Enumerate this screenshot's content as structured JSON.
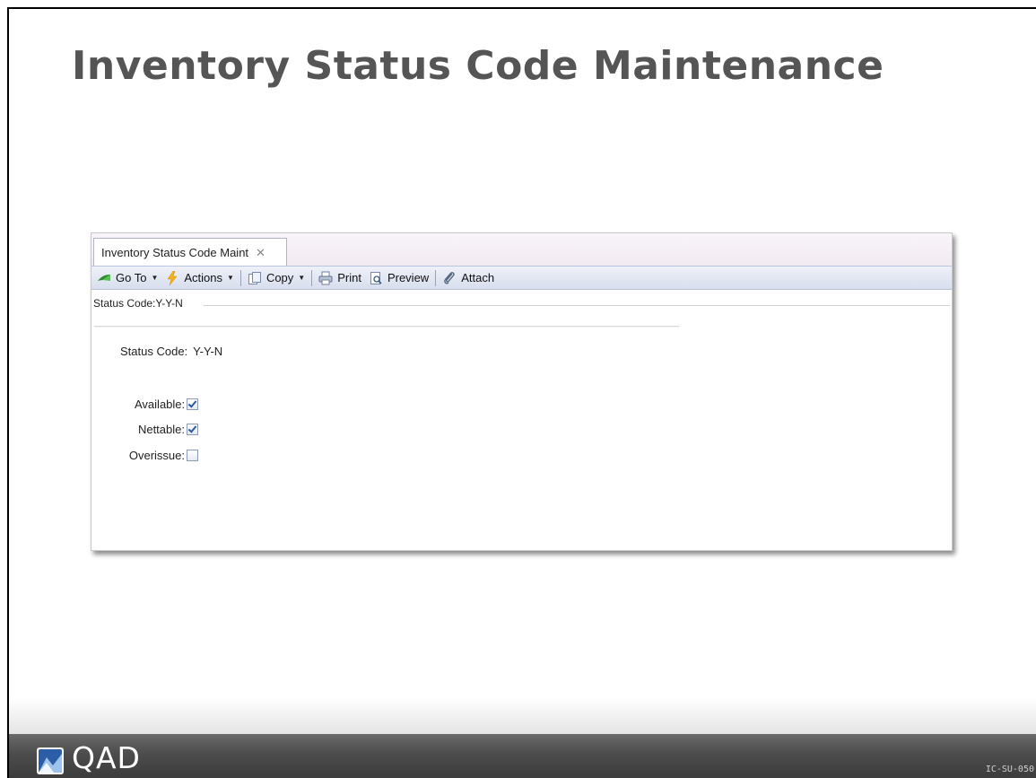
{
  "slide": {
    "title": "Inventory Status Code Maintenance",
    "code": "IC-SU-050"
  },
  "app": {
    "tab": {
      "label": "Inventory Status Code Maint",
      "close": "✕"
    },
    "toolbar": {
      "goto_label": "Go To",
      "actions_label": "Actions",
      "copy_label": "Copy",
      "print_label": "Print",
      "preview_label": "Preview",
      "attach_label": "Attach"
    },
    "section_legend": "Status Code:Y-Y-N",
    "form": {
      "status_code_label": "Status Code:",
      "status_code_value": "Y-Y-N",
      "available_label": "Available:",
      "available_checked": true,
      "nettable_label": "Nettable:",
      "nettable_checked": true,
      "overissue_label": "Overissue:",
      "overissue_checked": false
    }
  },
  "footer": {
    "logo_text": "QAD"
  },
  "colors": {
    "title": "#555555",
    "toolbar": "#dce2ef",
    "footer": "#4c4c4c"
  }
}
